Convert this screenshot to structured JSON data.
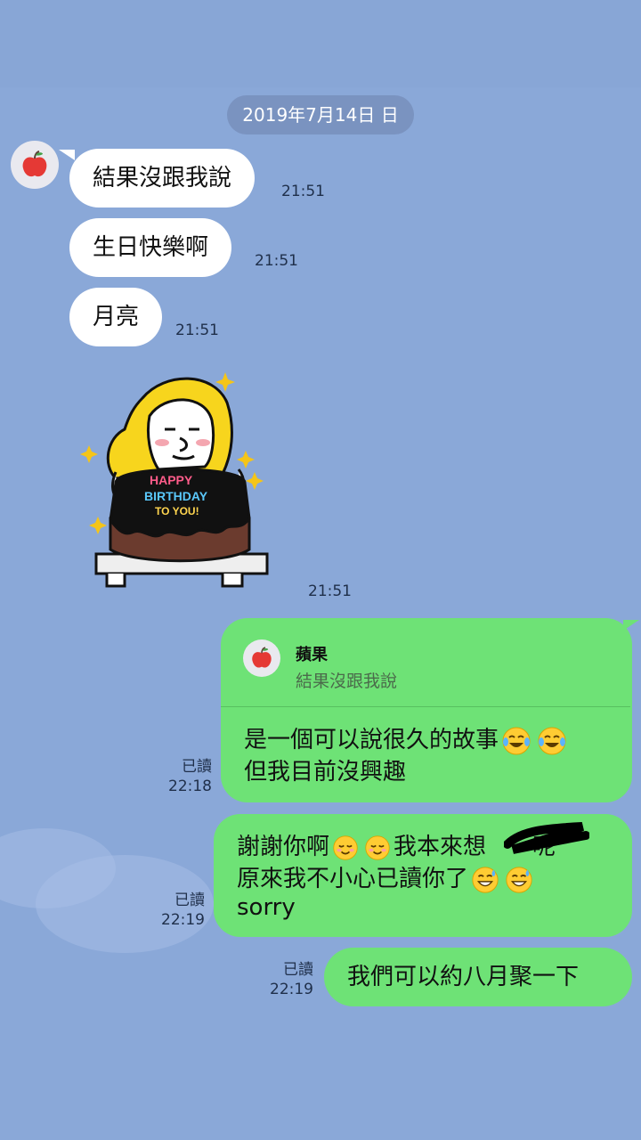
{
  "date_divider": "2019年7月14日 日",
  "incoming": {
    "messages": [
      {
        "text": "結果沒跟我說",
        "time": "21:51"
      },
      {
        "text": "生日快樂啊",
        "time": "21:51"
      },
      {
        "text": "月亮",
        "time": "21:51"
      }
    ],
    "sticker": {
      "text": "HAPPY BIRTHDAY TO YOU!",
      "time": "21:51"
    }
  },
  "outgoing": {
    "reply": {
      "quoted_name": "蘋果",
      "quoted_text": "結果沒跟我說",
      "lines": [
        "是一個可以說很久的故事",
        "但我目前沒興趣"
      ],
      "read_label": "已讀",
      "time": "22:18"
    },
    "message2": {
      "lines": [
        "謝謝你啊",
        "我本來想",
        "呢",
        "原來我不小心已讀你了",
        "sorry"
      ],
      "read_label": "已讀",
      "time": "22:19"
    },
    "message3": {
      "text": "我們可以約八月聚一下",
      "read_label": "已讀",
      "time": "22:19"
    }
  },
  "icons": {
    "avatar": "red-apple-icon",
    "laugh": "tears-of-joy-emoji",
    "smile": "smiling-face-emoji",
    "sweat": "grinning-sweat-emoji"
  },
  "colors": {
    "background": "#8aa8d8",
    "outgoing_bubble": "#6ee276",
    "incoming_bubble": "#ffffff",
    "date_pill": "#7a93c0"
  }
}
